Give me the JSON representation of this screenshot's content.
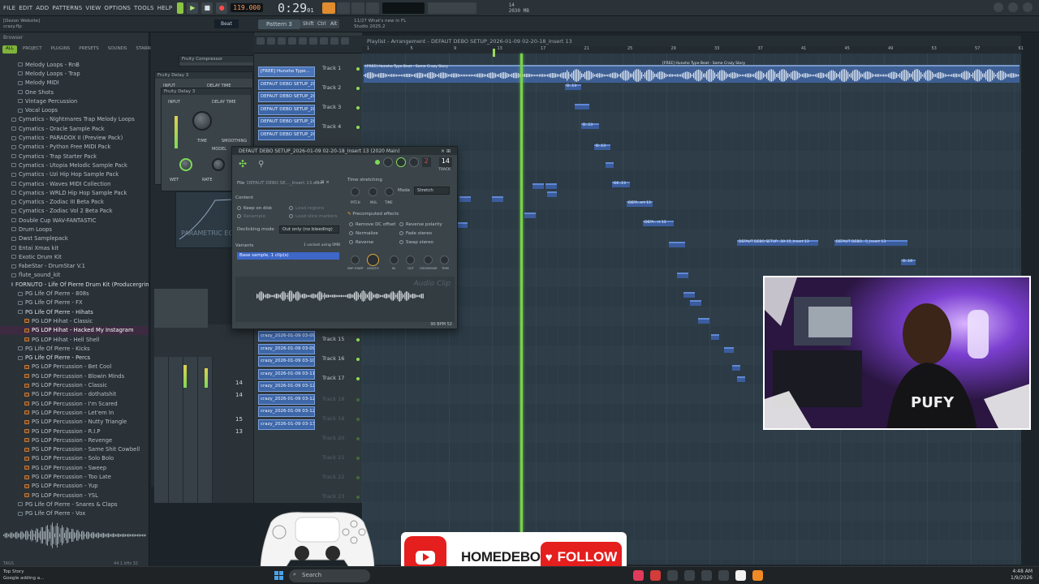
{
  "menu": [
    "File",
    "Edit",
    "Add",
    "Patterns",
    "View",
    "Options",
    "Tools",
    "Help"
  ],
  "transport": {
    "tempo": "119.000",
    "time": "0:29",
    "time_small": "01"
  },
  "cpu": {
    "line1": "14",
    "line2": "2030 MB"
  },
  "bar2": {
    "hint_line1": "[Dezon Website]",
    "hint_line2": "crazy.flp",
    "pattern": "Pattern 3",
    "snap": "Beat",
    "btn_shift": "Shift",
    "btn_ctrl": "Ctrl",
    "btn_alt": "Alt",
    "news_line1": "11/27 What's new in FL",
    "news_line2": "Studio 2025.2"
  },
  "browser": {
    "header": "Browser",
    "tabs": [
      "All",
      "Project",
      "Plugins",
      "Presets",
      "Sounds",
      "Starred"
    ],
    "items": [
      {
        "label": "Melody Loops - RnB",
        "indent": 2,
        "kind": "folder"
      },
      {
        "label": "Melody Loops - Trap",
        "indent": 2,
        "kind": "folder"
      },
      {
        "label": "Melody MIDI",
        "indent": 2,
        "kind": "folder"
      },
      {
        "label": "One Shots",
        "indent": 2,
        "kind": "folder"
      },
      {
        "label": "Vintage Percussion",
        "indent": 2,
        "kind": "folder"
      },
      {
        "label": "Vocal Loops",
        "indent": 2,
        "kind": "folder"
      },
      {
        "label": "Cymatics - Nightmares Trap Melody Loops",
        "indent": 1,
        "kind": "folder"
      },
      {
        "label": "Cymatics - Oracle Sample Pack",
        "indent": 1,
        "kind": "folder"
      },
      {
        "label": "Cymatics - PARADOX II (Preview Pack)",
        "indent": 1,
        "kind": "folder"
      },
      {
        "label": "Cymatics - Python Free MIDI Pack",
        "indent": 1,
        "kind": "folder"
      },
      {
        "label": "Cymatics - Trap Starter Pack",
        "indent": 1,
        "kind": "folder"
      },
      {
        "label": "Cymatics - Utopia Melodic Sample Pack",
        "indent": 1,
        "kind": "folder"
      },
      {
        "label": "Cymatics - Uzi Hip Hop Sample Pack",
        "indent": 1,
        "kind": "folder"
      },
      {
        "label": "Cymatics - Waves MIDI Collection",
        "indent": 1,
        "kind": "folder"
      },
      {
        "label": "Cymatics - WRLD Hip Hop Sample Pack",
        "indent": 1,
        "kind": "folder"
      },
      {
        "label": "Cymatics - Zodiac III Beta Pack",
        "indent": 1,
        "kind": "folder"
      },
      {
        "label": "Cymatics - Zodiac Vol 2 Beta Pack",
        "indent": 1,
        "kind": "folder"
      },
      {
        "label": "Double Cup WAV-FANTASTIC",
        "indent": 1,
        "kind": "folder"
      },
      {
        "label": "Drum Loops",
        "indent": 1,
        "kind": "folder"
      },
      {
        "label": "Dwst Samplepack",
        "indent": 1,
        "kind": "folder"
      },
      {
        "label": "Entai Xmas kit",
        "indent": 1,
        "kind": "folder"
      },
      {
        "label": "Exotic Drum Kit",
        "indent": 1,
        "kind": "folder"
      },
      {
        "label": "FabeStar - DrumStar V.1",
        "indent": 1,
        "kind": "folder"
      },
      {
        "label": "flute_sound_kit",
        "indent": 1,
        "kind": "folder"
      },
      {
        "label": "FORNUTO - Life Of Pierre Drum Kit (Producergrind)",
        "indent": 1,
        "kind": "open"
      },
      {
        "label": "PG Life Of Pierre - 808s",
        "indent": 2,
        "kind": "folder"
      },
      {
        "label": "PG Life Of Pierre - FX",
        "indent": 2,
        "kind": "folder"
      },
      {
        "label": "PG Life Of Pierre - Hihats",
        "indent": 2,
        "kind": "open"
      },
      {
        "label": "PG LOP Hihat - Classic",
        "indent": 3,
        "kind": "file"
      },
      {
        "label": "PG LOP Hihat - Hacked My Instagram",
        "indent": 3,
        "kind": "sel"
      },
      {
        "label": "PG LOP Hihat - Hell Shell",
        "indent": 3,
        "kind": "file"
      },
      {
        "label": "PG Life Of Pierre - Kicks",
        "indent": 2,
        "kind": "folder"
      },
      {
        "label": "PG Life Of Pierre - Percs",
        "indent": 2,
        "kind": "open"
      },
      {
        "label": "PG LOP Percussion - Bet Cool",
        "indent": 3,
        "kind": "file"
      },
      {
        "label": "PG LOP Percussion - Blowin Minds",
        "indent": 3,
        "kind": "file"
      },
      {
        "label": "PG LOP Percussion - Classic",
        "indent": 3,
        "kind": "file"
      },
      {
        "label": "PG LOP Percussion - dothatshit",
        "indent": 3,
        "kind": "file"
      },
      {
        "label": "PG LOP Percussion - I'm Scared",
        "indent": 3,
        "kind": "file"
      },
      {
        "label": "PG LOP Percussion - Let'em In",
        "indent": 3,
        "kind": "file"
      },
      {
        "label": "PG LOP Percussion - Nutty Triangle",
        "indent": 3,
        "kind": "file"
      },
      {
        "label": "PG LOP Percussion - R.I.P",
        "indent": 3,
        "kind": "file"
      },
      {
        "label": "PG LOP Percussion - Revenge",
        "indent": 3,
        "kind": "file"
      },
      {
        "label": "PG LOP Percussion - Same Shit Cowbell",
        "indent": 3,
        "kind": "file"
      },
      {
        "label": "PG LOP Percussion - Solo Bolo",
        "indent": 3,
        "kind": "file"
      },
      {
        "label": "PG LOP Percussion - Sweep",
        "indent": 3,
        "kind": "file"
      },
      {
        "label": "PG LOP Percussion - Too Late",
        "indent": 3,
        "kind": "file"
      },
      {
        "label": "PG LOP Percussion - Yup",
        "indent": 3,
        "kind": "file"
      },
      {
        "label": "PG LOP Percussion - YSL",
        "indent": 3,
        "kind": "file"
      },
      {
        "label": "PG Life Of Pierre - Snares & Claps",
        "indent": 2,
        "kind": "folder"
      },
      {
        "label": "PG Life Of Pierre - Vox",
        "indent": 2,
        "kind": "folder"
      }
    ],
    "footer_left": "TAGS",
    "footer_right": "44.1 kHz 32"
  },
  "plugins": {
    "delay1": "Fruity Delay 3",
    "delay2": "Fruity Delay 3",
    "compressor": "Fruity Compressor",
    "input": "INPUT",
    "delay_time": "DELAY TIME",
    "model": "MODEL",
    "wet": "WET",
    "rate": "RATE",
    "time": "TIME",
    "smoothing": "SMOOTHING",
    "parametric": "PARAMETRIC EQ",
    "mixer_nums": [
      "14",
      "14",
      "15",
      "13"
    ]
  },
  "rack": {
    "channels": [
      "[FREE] Hunxho Type...",
      "DEFAUT DEBO SETUP_202...",
      "DEFAUT DEBO SETUP_202...",
      "DEFAUT DEBO SETUP_202...",
      "DEFAUT DEBO SETUP_202...",
      "DEFAUT DEBO SETUP_202..."
    ],
    "channels2": [
      "crazy_2026-01-09 03-09...",
      "crazy_2026-01-09 03-09...",
      "crazy_2026-01-09 03-10...",
      "crazy_2026-01-09 03-11...",
      "crazy_2026-01-09 03-12...",
      "crazy_2026-01-09 03-12...",
      "crazy_2026-01-09 03-12...",
      "crazy_2026-01-09 03-13..."
    ],
    "tracks_top": [
      "Track 1",
      "Track 2",
      "Track 3",
      "Track 4"
    ],
    "tracks_mid": [
      "Track 15",
      "Track 16",
      "Track 17"
    ],
    "tracks_dim": [
      "Track 18",
      "Track 19",
      "Track 20",
      "Track 21",
      "Track 22",
      "Track 23"
    ]
  },
  "playlist": {
    "title": "Playlist - Arrangement - DEFAUT DEBO SETUP_2026-01-09 02-20-18_Insert 13",
    "ruler": [
      "1",
      "5",
      "9",
      "13",
      "17",
      "21",
      "25",
      "29",
      "33",
      "37",
      "41",
      "45",
      "49",
      "53",
      "57",
      "61"
    ],
    "clip_top": "[FREE] Hunxho Type Beat - Some Crazy Story",
    "clip_top2": "[FREE] Hunxho Type Beat - Some Crazy Story",
    "clips": [
      {
        "label": "D..13"
      },
      {
        "label": ""
      },
      {
        "label": "D..13"
      },
      {
        "label": "D..13"
      },
      {
        "label": ""
      },
      {
        "label": "DE..13"
      },
      {
        "label": "DEFA..ert 13"
      },
      {
        "label": "DEFA...rt 13"
      },
      {
        "label": ""
      },
      {
        "label": "DEFAUT DEBO SETUP...30-15_Insert 13"
      },
      {
        "label": "DEFAUT DEBO...5_Insert 13"
      },
      {
        "label": "D..16"
      }
    ]
  },
  "audio_clip": {
    "title": "DEFAUT DEBO SETUP_2026-01-09 02-20-18_Insert 13 (2020 Main)",
    "file_label": "File",
    "file_value": "DEFAUT DEBO SE..._Insert 13.wav",
    "content_label": "Content",
    "keep_on_disk": "Keep on disk",
    "load_regions": "Load regions",
    "resample": "Resample",
    "load_markers": "Load slice markers",
    "declicking_label": "Declicking mode",
    "declicking_value": "Out only (no bleeding)",
    "variants_label": "Variants",
    "variants_info": "1 variant using 0MB",
    "variant_item": "Base sample, 1 clip(s)",
    "time_stretching": "Time stretching",
    "mode_label": "Mode",
    "mode_value": "Stretch",
    "pitch": "PITCH",
    "mul": "MUL",
    "time": "TIME",
    "precomputed": "Precomputed effects",
    "remove_dc": "Remove DC offset",
    "reverse_polarity": "Reverse polarity",
    "normalize": "Normalize",
    "fade_stereo": "Fade stereo",
    "reverse": "Reverse",
    "swap_stereo": "Swap stereo",
    "fx_knobs": [
      "SMP START",
      "LENGTH",
      "IN",
      "OUT",
      "CROSSFADE",
      "TRIM"
    ],
    "watermark": "Audio Clip",
    "bpm": "90 BPM 52",
    "track_num": "2",
    "track_num2": "14",
    "track_label": "TRACK"
  },
  "banner": {
    "channel": "HOMEDEBO",
    "follow": "FOLLOW"
  },
  "taskbar": {
    "news1": "Top Story",
    "news2": "Google adding a...",
    "search": "Search",
    "time": "4:48 AM",
    "date": "1/9/2026"
  },
  "colors": {
    "accent": "#7ed957",
    "clip": "#3b5c9d",
    "playhead": "#78d24a",
    "youtube": "#e51e1e"
  }
}
